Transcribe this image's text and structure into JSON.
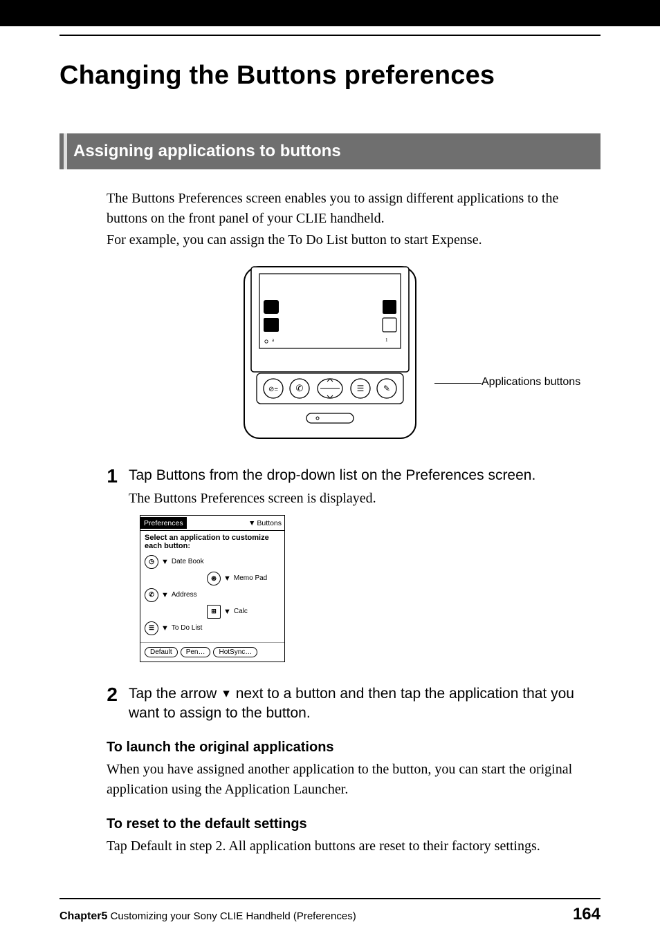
{
  "page_title": "Changing the Buttons preferences",
  "section_heading": "Assigning applications to buttons",
  "intro_p1": "The Buttons Preferences screen enables you to assign different applications to the buttons on the front panel of your CLIE handheld.",
  "intro_p2": "For example, you can assign the To Do List button to start Expense.",
  "device_callout": "Applications buttons",
  "step1": {
    "num": "1",
    "head": "Tap Buttons from the drop-down list on the Preferences screen.",
    "note": "The Buttons Preferences screen is displayed."
  },
  "palm_screen": {
    "title_left": "Preferences",
    "title_right": "Buttons",
    "instruction": "Select an application to customize each button:",
    "rows": [
      {
        "icon": "clock-icon",
        "label": "Date Book"
      },
      {
        "icon": "spiral-icon",
        "label": "Memo Pad",
        "offset": true
      },
      {
        "icon": "phone-icon",
        "label": "Address"
      },
      {
        "icon": "calc-icon",
        "label": "Calc",
        "offset": true,
        "square": true
      },
      {
        "icon": "list-icon",
        "label": "To Do List"
      }
    ],
    "buttons": [
      "Default",
      "Pen…",
      "HotSync…"
    ]
  },
  "step2": {
    "num": "2",
    "head_pre": "Tap the arrow ",
    "head_post": " next to a button and then tap the application that you want to assign to the button."
  },
  "sub1": {
    "head": "To launch the original applications",
    "body": "When you have assigned another application to the button, you can start the original application using the Application Launcher."
  },
  "sub2": {
    "head": "To reset to the default settings",
    "body": "Tap Default in step 2. All application buttons are reset to their factory settings."
  },
  "footer": {
    "chapter_label": "Chapter5",
    "chapter_desc": "  Customizing your Sony CLIE Handheld (Preferences)",
    "page_number": "164"
  }
}
